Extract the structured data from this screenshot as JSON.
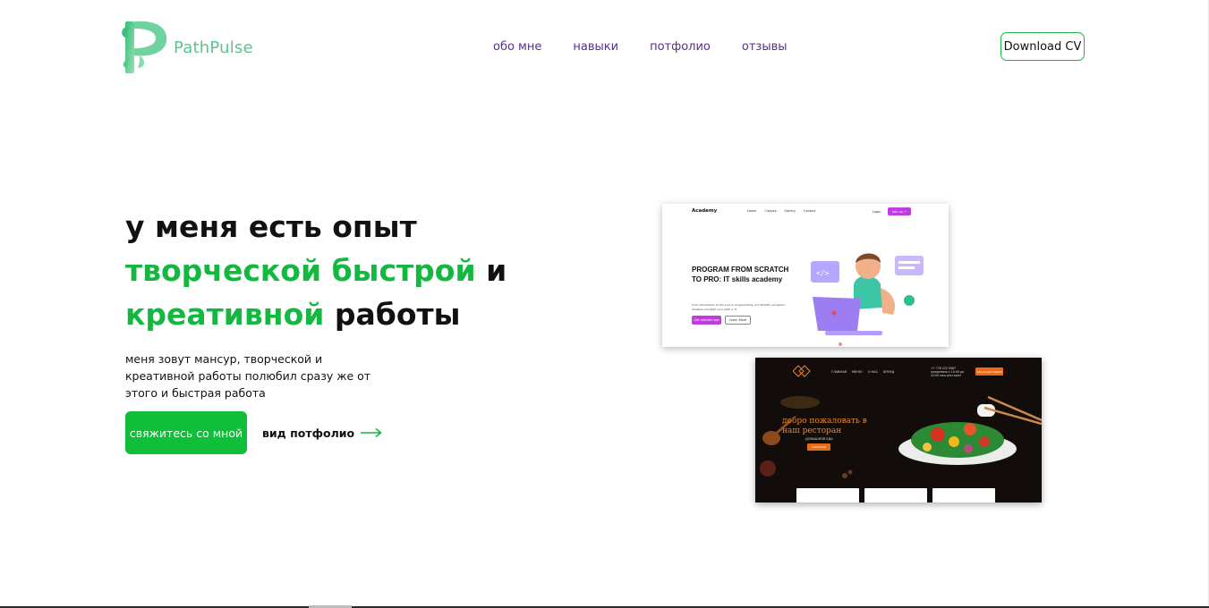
{
  "header": {
    "logo_text": "PathPulse",
    "nav": [
      "обо мне",
      "навыки",
      "потфолио",
      "отзывы"
    ],
    "download_label": "Download CV"
  },
  "hero": {
    "title_line1": "у меня есть опыт",
    "title_green1": "творческой быстрой",
    "title_plain1": " и",
    "title_green2": "креативной",
    "title_plain2": " работы",
    "description": "меня зовут мансур, творческой и креативной работы полюбил сразу же от этого и быстрая работа",
    "cta_label": "свяжитесь со мной",
    "portfolio_label": "вид потфолио"
  },
  "portfolio_preview_academy": {
    "brand": "Academy",
    "nav": [
      "Home",
      "Classes",
      "Gallery",
      "Contact"
    ],
    "login": "Login",
    "join": "Join us →",
    "headline": "PROGRAM FROM SCRATCH TO PRO: IT skills academy",
    "sub": "from introduction to the pros in programming. Join 50,000 successful students and start your path in IT",
    "btn_primary": "Get started now",
    "btn_secondary": "Learn More"
  },
  "portfolio_preview_restaurant": {
    "nav": [
      "ГЛАВНАЯ",
      "МЕНЮ",
      "О НАС",
      "БРЕНД"
    ],
    "phone": "+7 776 222 0987 ежедневно с 10:00 до 22:00 наш ресторан",
    "order": "ЗАКАЗ ДОСТАВКИ",
    "welcome": "добро пожаловать в наш ресторан",
    "sub": "ДОМАШНЯЯ ЕДА",
    "btn": "ЗАКАЗАТЬ"
  },
  "colors": {
    "accent_green": "#12b83f",
    "nav_purple": "#5a2d91",
    "academy_magenta": "#c23be0",
    "restaurant_orange": "#ea6a18"
  }
}
